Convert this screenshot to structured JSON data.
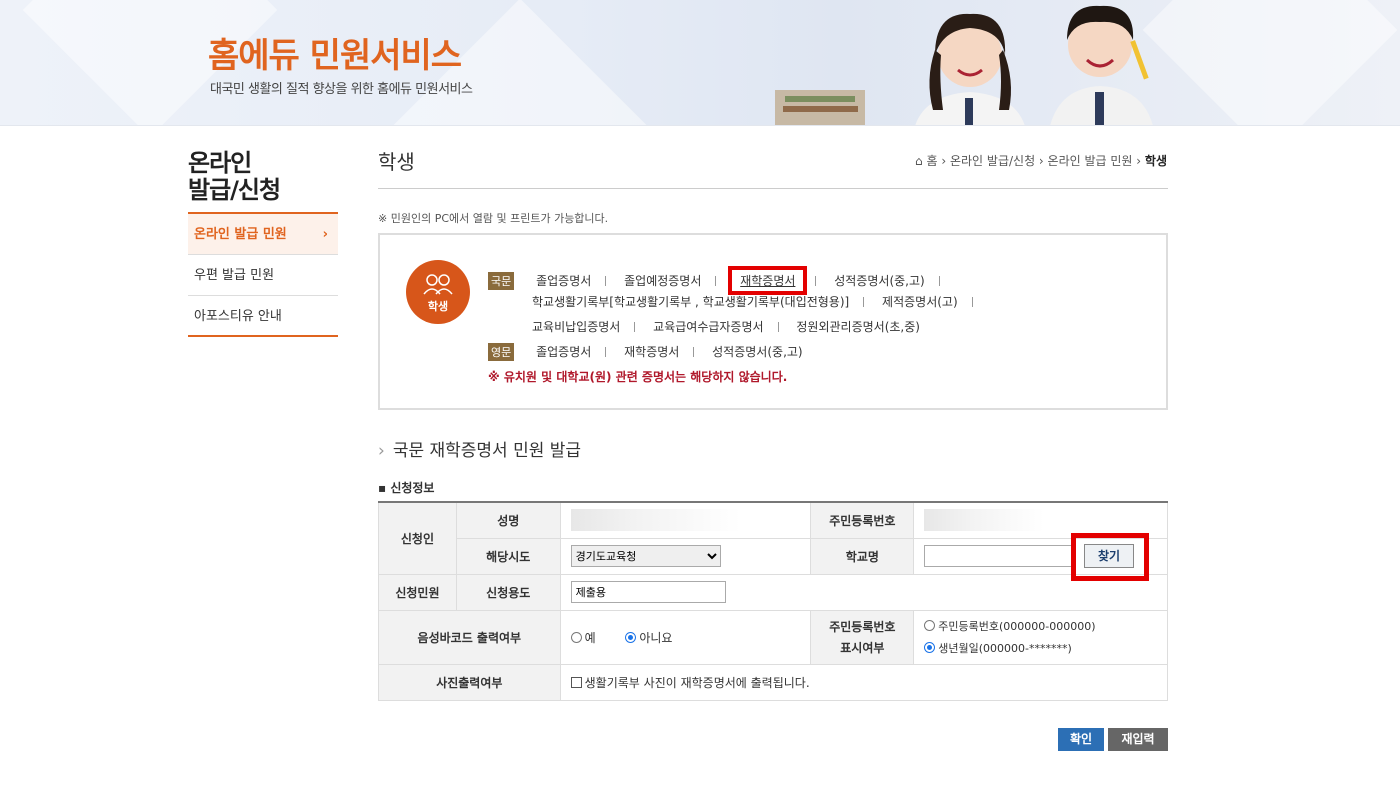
{
  "banner": {
    "title": "홈에듀 민원서비스",
    "subtitle": "대국민 생활의 질적 향상을 위한 홈에듀 민원서비스"
  },
  "sidebar": {
    "title_line1": "온라인",
    "title_line2": "발급/신청",
    "items": [
      {
        "label": "온라인 발급 민원",
        "active": true
      },
      {
        "label": "우편 발급 민원"
      },
      {
        "label": "아포스티유 안내"
      }
    ]
  },
  "header": {
    "title": "학생",
    "breadcrumb": [
      "홈",
      "온라인 발급/신청",
      "온라인 발급 민원",
      "학생"
    ]
  },
  "note": "※ 민원인의 PC에서 열람 및 프린트가 가능합니다.",
  "certs": {
    "icon_label": "학생",
    "korean_tag": "국문",
    "english_tag": "영문",
    "korean_row1": [
      "졸업증명서",
      "졸업예정증명서",
      "재학증명서",
      "성적증명서(중,고)"
    ],
    "korean_row2": [
      "학교생활기록부[학교생활기록부 , 학교생활기록부(대입전형용)]",
      "제적증명서(고)"
    ],
    "korean_row3": [
      "교육비납입증명서",
      "교육급여수급자증명서",
      "정원외관리증명서(초,중)"
    ],
    "english_row": [
      "졸업증명서",
      "재학증명서",
      "성적증명서(중,고)"
    ],
    "warning": "※ 유치원 및 대학교(원) 관련 증명서는 해당하지 않습니다."
  },
  "section_title": "국문 재학증명서 민원 발급",
  "form_title": "신청정보",
  "form": {
    "applicant": "신청인",
    "name": "성명",
    "rrn": "주민등록번호",
    "province": "해당시도",
    "province_value": "경기도교육청",
    "school": "학교명",
    "find_button": "찾기",
    "request": "신청민원",
    "purpose": "신청용도",
    "purpose_value": "제출용",
    "barcode": "음성바코드 출력여부",
    "barcode_yes": "예",
    "barcode_no": "아니요",
    "rrn_display_line1": "주민등록번호",
    "rrn_display_line2": "표시여부",
    "rrn_option1": "주민등록번호(000000-000000)",
    "rrn_option2": "생년월일(000000-*******)",
    "photo": "사진출력여부",
    "photo_check": "생활기록부 사진이 재학증명서에 출력됩니다."
  },
  "buttons": {
    "confirm": "확인",
    "reset": "재입력"
  },
  "colors": {
    "accent": "#e0641f",
    "highlight": "#e30000",
    "primary_button": "#2c6fb5"
  }
}
